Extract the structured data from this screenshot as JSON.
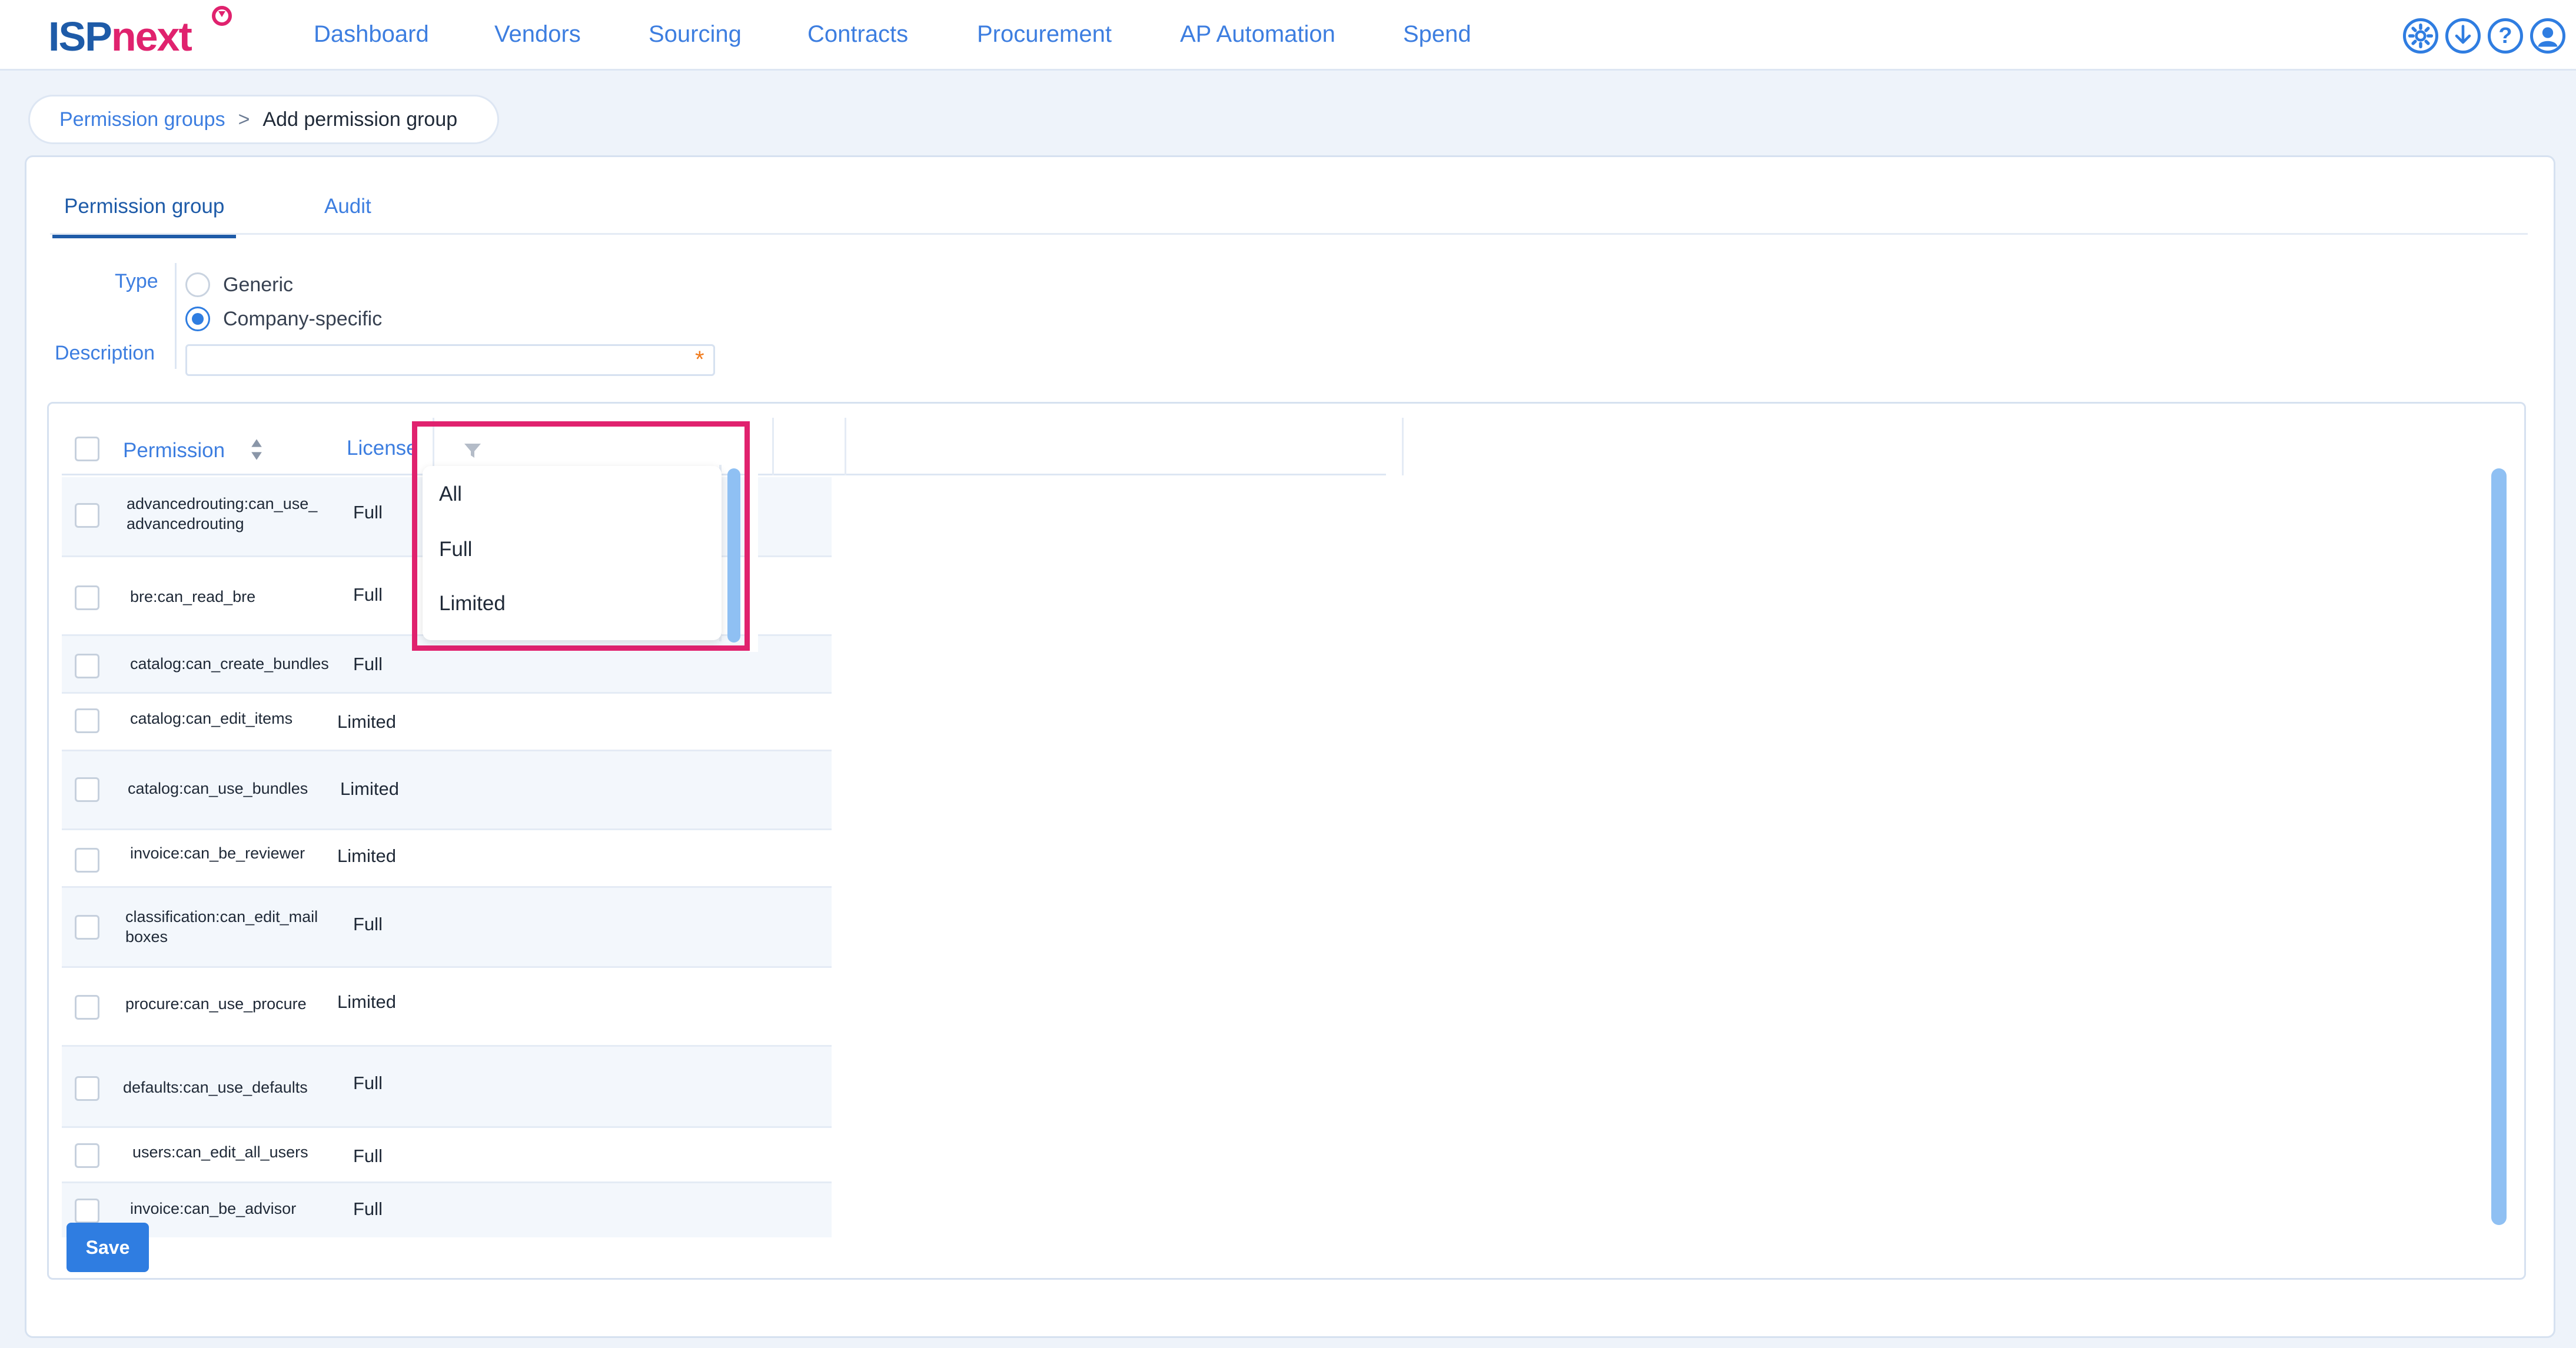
{
  "app": {
    "logo_isp": "ISP",
    "logo_next": "next",
    "nav": [
      {
        "label": "Dashboard"
      },
      {
        "label": "Vendors"
      },
      {
        "label": "Sourcing"
      },
      {
        "label": "Contracts"
      },
      {
        "label": "Procurement"
      },
      {
        "label": "AP Automation"
      },
      {
        "label": "Spend"
      }
    ],
    "icons": [
      "gear-icon",
      "download-icon",
      "help-icon",
      "user-icon"
    ],
    "help_glyph": "?"
  },
  "breadcrumb": {
    "parent": "Permission groups",
    "separator": ">",
    "current": "Add permission group"
  },
  "tabs": {
    "active": "Permission group",
    "inactive": "Audit"
  },
  "form": {
    "type_label": "Type",
    "type_options": [
      "Generic",
      "Company-specific"
    ],
    "type_selected": "Company-specific",
    "description_label": "Description",
    "description_value": "",
    "required_mark": "*"
  },
  "table": {
    "col_permission": "Permission",
    "col_license": "License",
    "rows": [
      {
        "permission": "advancedrouting:can_use_\nadvancedrouting",
        "license": "Full"
      },
      {
        "permission": "bre:can_read_bre",
        "license": "Full"
      },
      {
        "permission": "catalog:can_create_bundles",
        "license": "Full"
      },
      {
        "permission": "catalog:can_edit_items",
        "license": "Limited"
      },
      {
        "permission": "catalog:can_use_bundles",
        "license": "Limited"
      },
      {
        "permission": "invoice:can_be_reviewer",
        "license": "Limited"
      },
      {
        "permission": "classification:can_edit_mail\nboxes",
        "license": "Full"
      },
      {
        "permission": "procure:can_use_procure",
        "license": "Limited"
      },
      {
        "permission": "defaults:can_use_defaults",
        "license": "Full"
      },
      {
        "permission": "users:can_edit_all_users",
        "license": "Full"
      },
      {
        "permission": "invoice:can_be_advisor",
        "license": "Full"
      }
    ],
    "save_label": "Save"
  },
  "license_filter": {
    "options": [
      "All",
      "Full",
      "Limited"
    ]
  },
  "colors": {
    "brand_blue": "#1e5ba8",
    "brand_pink": "#e0226e",
    "accent": "#2f7de1",
    "highlight": "#e0226e"
  }
}
